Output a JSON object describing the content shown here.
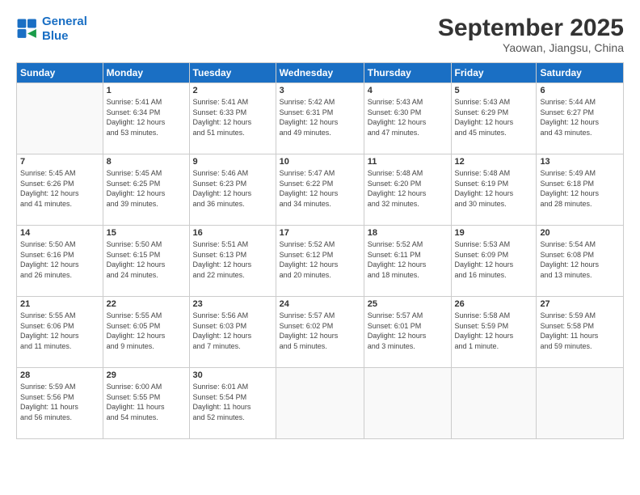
{
  "header": {
    "logo_line1": "General",
    "logo_line2": "Blue",
    "month": "September 2025",
    "location": "Yaowan, Jiangsu, China"
  },
  "weekdays": [
    "Sunday",
    "Monday",
    "Tuesday",
    "Wednesday",
    "Thursday",
    "Friday",
    "Saturday"
  ],
  "weeks": [
    [
      {
        "day": "",
        "info": ""
      },
      {
        "day": "1",
        "info": "Sunrise: 5:41 AM\nSunset: 6:34 PM\nDaylight: 12 hours\nand 53 minutes."
      },
      {
        "day": "2",
        "info": "Sunrise: 5:41 AM\nSunset: 6:33 PM\nDaylight: 12 hours\nand 51 minutes."
      },
      {
        "day": "3",
        "info": "Sunrise: 5:42 AM\nSunset: 6:31 PM\nDaylight: 12 hours\nand 49 minutes."
      },
      {
        "day": "4",
        "info": "Sunrise: 5:43 AM\nSunset: 6:30 PM\nDaylight: 12 hours\nand 47 minutes."
      },
      {
        "day": "5",
        "info": "Sunrise: 5:43 AM\nSunset: 6:29 PM\nDaylight: 12 hours\nand 45 minutes."
      },
      {
        "day": "6",
        "info": "Sunrise: 5:44 AM\nSunset: 6:27 PM\nDaylight: 12 hours\nand 43 minutes."
      }
    ],
    [
      {
        "day": "7",
        "info": "Sunrise: 5:45 AM\nSunset: 6:26 PM\nDaylight: 12 hours\nand 41 minutes."
      },
      {
        "day": "8",
        "info": "Sunrise: 5:45 AM\nSunset: 6:25 PM\nDaylight: 12 hours\nand 39 minutes."
      },
      {
        "day": "9",
        "info": "Sunrise: 5:46 AM\nSunset: 6:23 PM\nDaylight: 12 hours\nand 36 minutes."
      },
      {
        "day": "10",
        "info": "Sunrise: 5:47 AM\nSunset: 6:22 PM\nDaylight: 12 hours\nand 34 minutes."
      },
      {
        "day": "11",
        "info": "Sunrise: 5:48 AM\nSunset: 6:20 PM\nDaylight: 12 hours\nand 32 minutes."
      },
      {
        "day": "12",
        "info": "Sunrise: 5:48 AM\nSunset: 6:19 PM\nDaylight: 12 hours\nand 30 minutes."
      },
      {
        "day": "13",
        "info": "Sunrise: 5:49 AM\nSunset: 6:18 PM\nDaylight: 12 hours\nand 28 minutes."
      }
    ],
    [
      {
        "day": "14",
        "info": "Sunrise: 5:50 AM\nSunset: 6:16 PM\nDaylight: 12 hours\nand 26 minutes."
      },
      {
        "day": "15",
        "info": "Sunrise: 5:50 AM\nSunset: 6:15 PM\nDaylight: 12 hours\nand 24 minutes."
      },
      {
        "day": "16",
        "info": "Sunrise: 5:51 AM\nSunset: 6:13 PM\nDaylight: 12 hours\nand 22 minutes."
      },
      {
        "day": "17",
        "info": "Sunrise: 5:52 AM\nSunset: 6:12 PM\nDaylight: 12 hours\nand 20 minutes."
      },
      {
        "day": "18",
        "info": "Sunrise: 5:52 AM\nSunset: 6:11 PM\nDaylight: 12 hours\nand 18 minutes."
      },
      {
        "day": "19",
        "info": "Sunrise: 5:53 AM\nSunset: 6:09 PM\nDaylight: 12 hours\nand 16 minutes."
      },
      {
        "day": "20",
        "info": "Sunrise: 5:54 AM\nSunset: 6:08 PM\nDaylight: 12 hours\nand 13 minutes."
      }
    ],
    [
      {
        "day": "21",
        "info": "Sunrise: 5:55 AM\nSunset: 6:06 PM\nDaylight: 12 hours\nand 11 minutes."
      },
      {
        "day": "22",
        "info": "Sunrise: 5:55 AM\nSunset: 6:05 PM\nDaylight: 12 hours\nand 9 minutes."
      },
      {
        "day": "23",
        "info": "Sunrise: 5:56 AM\nSunset: 6:03 PM\nDaylight: 12 hours\nand 7 minutes."
      },
      {
        "day": "24",
        "info": "Sunrise: 5:57 AM\nSunset: 6:02 PM\nDaylight: 12 hours\nand 5 minutes."
      },
      {
        "day": "25",
        "info": "Sunrise: 5:57 AM\nSunset: 6:01 PM\nDaylight: 12 hours\nand 3 minutes."
      },
      {
        "day": "26",
        "info": "Sunrise: 5:58 AM\nSunset: 5:59 PM\nDaylight: 12 hours\nand 1 minute."
      },
      {
        "day": "27",
        "info": "Sunrise: 5:59 AM\nSunset: 5:58 PM\nDaylight: 11 hours\nand 59 minutes."
      }
    ],
    [
      {
        "day": "28",
        "info": "Sunrise: 5:59 AM\nSunset: 5:56 PM\nDaylight: 11 hours\nand 56 minutes."
      },
      {
        "day": "29",
        "info": "Sunrise: 6:00 AM\nSunset: 5:55 PM\nDaylight: 11 hours\nand 54 minutes."
      },
      {
        "day": "30",
        "info": "Sunrise: 6:01 AM\nSunset: 5:54 PM\nDaylight: 11 hours\nand 52 minutes."
      },
      {
        "day": "",
        "info": ""
      },
      {
        "day": "",
        "info": ""
      },
      {
        "day": "",
        "info": ""
      },
      {
        "day": "",
        "info": ""
      }
    ]
  ]
}
